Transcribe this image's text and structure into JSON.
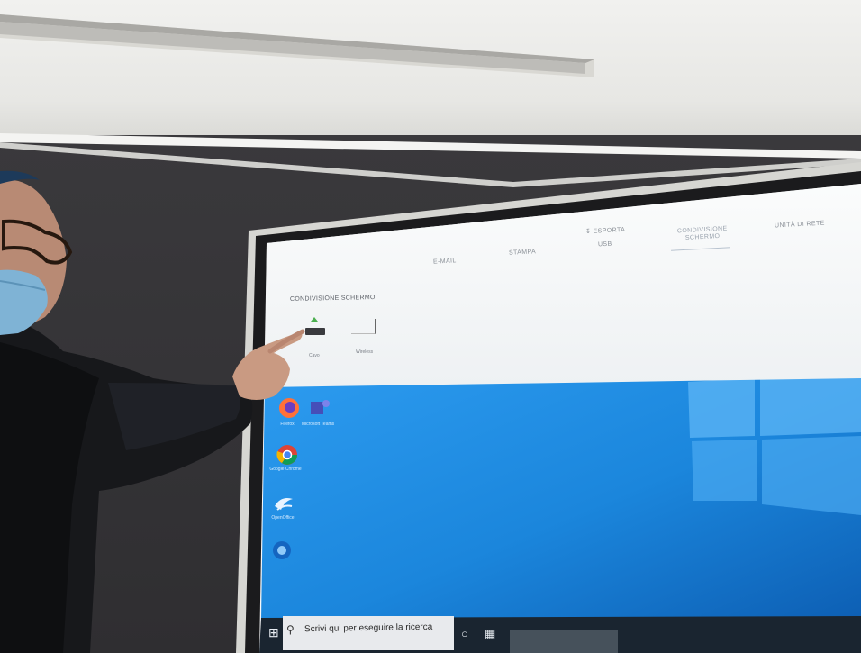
{
  "screen": {
    "tabs": [
      {
        "label": "E-MAIL"
      },
      {
        "label": "STAMPA"
      },
      {
        "label": "USB"
      },
      {
        "label": "CONDIVISIONE SCHERMO"
      },
      {
        "label": "UNITÀ DI RETE"
      }
    ],
    "export_label": "ESPORTA",
    "panel_title": "CONDIVISIONE SCHERMO",
    "sources": [
      {
        "label": "Cavo"
      },
      {
        "label": "Wireless"
      }
    ],
    "desktop_icons": [
      {
        "icon": "firefox-icon",
        "label": "Firefox"
      },
      {
        "icon": "teams-icon",
        "label": "Microsoft Teams"
      },
      {
        "icon": "chrome-icon",
        "label": "Google Chrome"
      },
      {
        "icon": "openoffice-icon",
        "label": "OpenOffice"
      },
      {
        "icon": "app-icon",
        "label": ""
      }
    ],
    "taskbar": {
      "search_placeholder": "Scrivi qui per eseguire la ricerca"
    }
  },
  "colors": {
    "desktop_blue": "#1f8fe0",
    "menu_bg": "#f4f6f7",
    "wall": "#2f2e31"
  }
}
